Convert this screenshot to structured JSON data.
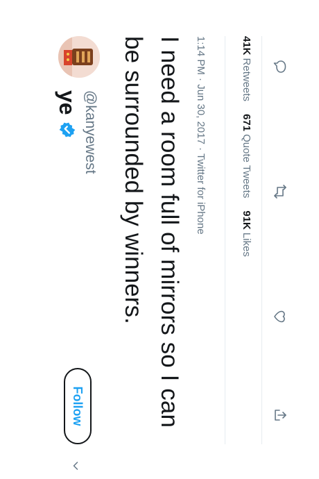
{
  "user": {
    "display_name": "ye",
    "handle": "@kanyewest",
    "verified": true
  },
  "follow_button": {
    "label": "Follow"
  },
  "tweet": {
    "text": "I need a room full of mirrors so I can be surrounded by winners.",
    "meta": "1:14 PM · Jun 30, 2017 · Twitter for iPhone"
  },
  "stats": {
    "retweets_count": "41K",
    "retweets_label": "Retweets",
    "quotes_count": "671",
    "quotes_label": "Quote Tweets",
    "likes_count": "91K",
    "likes_label": "Likes"
  },
  "actions": [
    "reply-icon",
    "retweet-icon",
    "like-icon",
    "share-icon"
  ],
  "colors": {
    "accent": "#1da1f2",
    "text": "#14171a",
    "secondary_text": "#657786",
    "divider": "#e6ecf0"
  }
}
